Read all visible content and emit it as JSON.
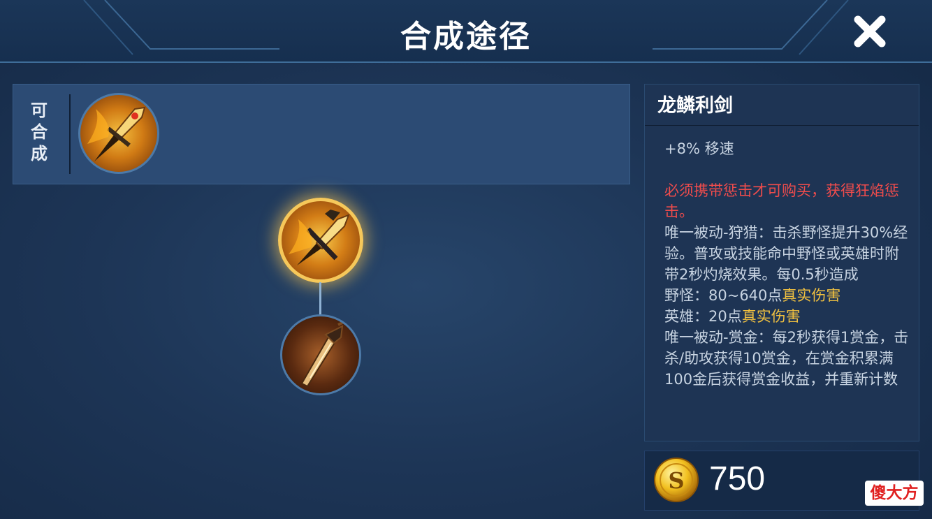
{
  "header": {
    "title": "合成途径",
    "close_icon": "close-x-icon"
  },
  "composable": {
    "label": "可合成",
    "items": [
      {
        "icon": "dragon-scale-sword-icon"
      }
    ]
  },
  "tree": {
    "root": {
      "icon": "dragon-scale-sword-icon",
      "selected": true
    },
    "children": [
      {
        "icon": "hunting-dagger-icon"
      }
    ]
  },
  "detail": {
    "name": "龙鳞利剑",
    "stat": "+8% 移速",
    "warning": "必须携带惩击才可购买，获得狂焰惩击。",
    "passive_hunt": "唯一被动-狩猎：击杀野怪提升30%经验。普攻或技能命中野怪或英雄时附带2秒灼烧效果。每0.5秒造成",
    "monster_prefix": "野怪：80~640点",
    "hero_prefix": "英雄：20点",
    "true_damage": "真实伤害",
    "passive_bounty": "唯一被动-赏金：每2秒获得1赏金，击杀/助攻获得10赏金，在赏金积累满100金后获得赏金收益，并重新计数"
  },
  "price": {
    "icon": "gold-coin-icon",
    "value": "750"
  },
  "watermark": "傻大方",
  "colors": {
    "warning": "#f04c4c",
    "highlight": "#f0c040",
    "glow": "#f6c85a"
  }
}
